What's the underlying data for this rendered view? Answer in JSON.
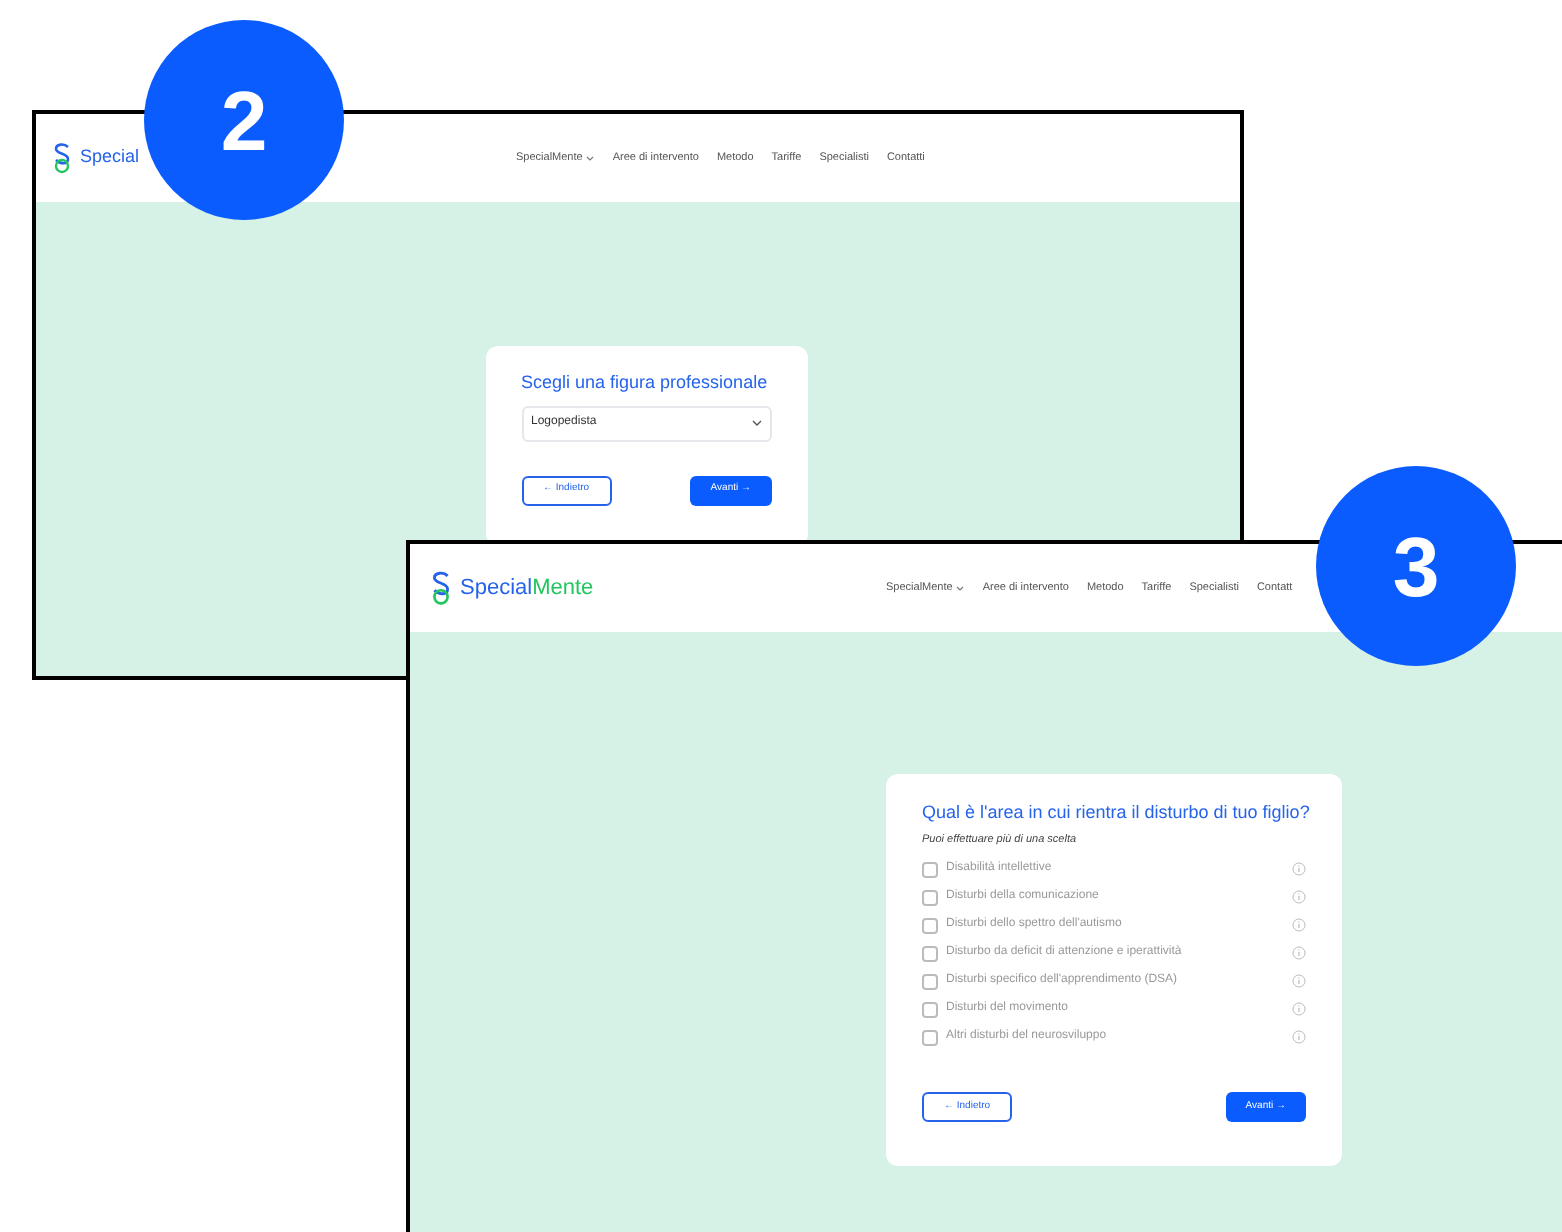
{
  "screens": [
    {
      "badge": "2",
      "logo": {
        "first": "Special"
      },
      "nav": [
        {
          "label": "SpecialMente",
          "dropdown": true
        },
        {
          "label": "Aree di intervento",
          "dropdown": false
        },
        {
          "label": "Metodo",
          "dropdown": false
        },
        {
          "label": "Tariffe",
          "dropdown": false
        },
        {
          "label": "Specialisti",
          "dropdown": false
        },
        {
          "label": "Contatti",
          "dropdown": false
        }
      ],
      "card": {
        "kind": "select",
        "title": "Scegli una figura professionale",
        "value": "Logopedista",
        "back": "← Indietro",
        "next": "Avanti →"
      }
    },
    {
      "badge": "3",
      "logo": {
        "first": "Special",
        "second": "Mente"
      },
      "nav": [
        {
          "label": "SpecialMente",
          "dropdown": true
        },
        {
          "label": "Aree di intervento",
          "dropdown": false
        },
        {
          "label": "Metodo",
          "dropdown": false
        },
        {
          "label": "Tariffe",
          "dropdown": false
        },
        {
          "label": "Specialisti",
          "dropdown": false
        },
        {
          "label": "Contatt",
          "dropdown": false
        }
      ],
      "card": {
        "kind": "checklist",
        "title": "Qual è l'area in cui rientra il disturbo di tuo figlio?",
        "subtitle": "Puoi effettuare più di una scelta",
        "options": [
          {
            "label": "Disabilità intellettive",
            "checked": false
          },
          {
            "label": "Disturbi della comunicazione",
            "checked": false
          },
          {
            "label": "Disturbi dello spettro dell'autismo",
            "checked": false
          },
          {
            "label": "Disturbo da deficit di attenzione e iperattività",
            "checked": false
          },
          {
            "label": "Disturbi specifico dell'apprendimento (DSA)",
            "checked": false
          },
          {
            "label": "Disturbi del movimento",
            "checked": false
          },
          {
            "label": "Altri disturbi del neurosviluppo",
            "checked": false
          }
        ],
        "back": "← Indietro",
        "next": "Avanti →"
      }
    }
  ]
}
